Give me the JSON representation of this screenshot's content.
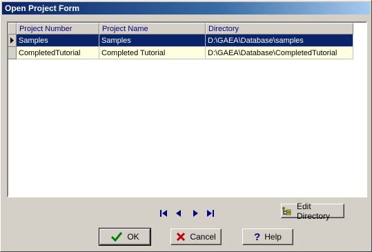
{
  "window": {
    "title": "Open Project Form"
  },
  "grid": {
    "columns": [
      "Project Number",
      "Project Name",
      "Directory"
    ],
    "rows": [
      [
        "Samples",
        "Samples",
        "D:\\GAEA\\Database\\samples"
      ],
      [
        "CompletedTutorial",
        "Completed Tutorial",
        "D:\\GAEA\\Database\\CompletedTutorial"
      ]
    ]
  },
  "buttons": {
    "edit_directory": "Edit Directory",
    "ok": "OK",
    "cancel": "Cancel",
    "help": "Help"
  },
  "navigator": [
    "first-record-icon",
    "prior-record-icon",
    "next-record-icon",
    "last-record-icon"
  ],
  "colors": {
    "selection": "#0a246a",
    "row_alt": "#ffffe1",
    "header_text": "#000080"
  }
}
